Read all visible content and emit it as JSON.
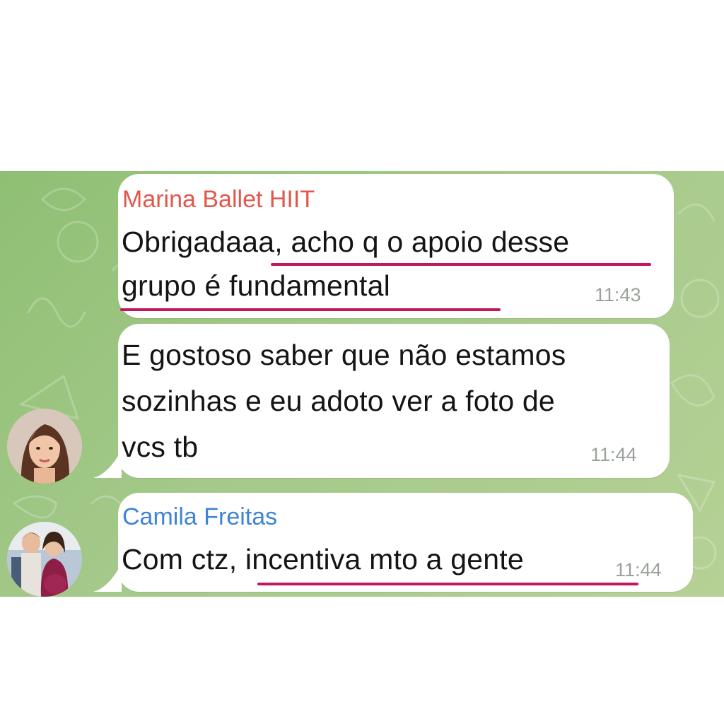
{
  "messages": [
    {
      "sender": "Marina Ballet HIIT",
      "sender_color": "#e2574c",
      "lines": [
        "Obrigadaaa, acho q o apoio desse",
        "grupo é fundamental"
      ],
      "time": "11:43"
    },
    {
      "sender": "",
      "lines": [
        "E gostoso saber que não estamos",
        "sozinhas e eu adoto ver a foto de",
        "vcs tb"
      ],
      "time": "11:44"
    },
    {
      "sender": "Camila Freitas",
      "sender_color": "#3f84d6",
      "lines": [
        "Com ctz, incentiva mto a gente"
      ],
      "time": "11:44"
    }
  ],
  "colors": {
    "chat_background": "#a4c98a",
    "bubble": "#ffffff",
    "highlight_underline": "#c2185b"
  },
  "icons": [
    "doodle-pattern",
    "avatar-marina",
    "avatar-camila"
  ]
}
